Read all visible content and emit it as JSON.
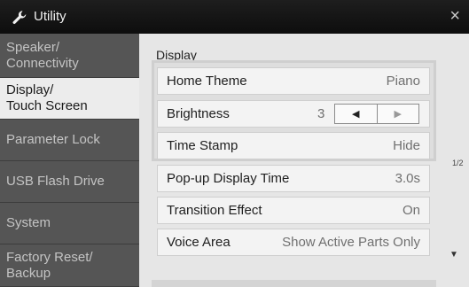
{
  "window": {
    "title": "Utility",
    "close_glyph": "×"
  },
  "sidebar": {
    "items": [
      {
        "line1": "Speaker/",
        "line2": "Connectivity",
        "active": false
      },
      {
        "line1": "Display/",
        "line2": "Touch Screen",
        "active": true
      },
      {
        "line1": "Parameter Lock",
        "line2": "",
        "active": false
      },
      {
        "line1": "USB Flash Drive",
        "line2": "",
        "active": false
      },
      {
        "line1": "System",
        "line2": "",
        "active": false
      },
      {
        "line1": "Factory Reset/",
        "line2": "Backup",
        "active": false
      }
    ]
  },
  "main": {
    "section_label": "Display",
    "rows": [
      {
        "label": "Home Theme",
        "value": "Piano"
      },
      {
        "label": "Brightness",
        "value": "3",
        "dec_glyph": "◀",
        "inc_glyph": "▶"
      },
      {
        "label": "Time Stamp",
        "value": "Hide"
      },
      {
        "label": "Pop-up Display Time",
        "value": "3.0s"
      },
      {
        "label": "Transition Effect",
        "value": "On"
      },
      {
        "label": "Voice Area",
        "value": "Show Active Parts Only"
      }
    ],
    "page_indicator": "1/2",
    "scroll_down_glyph": "▼"
  }
}
